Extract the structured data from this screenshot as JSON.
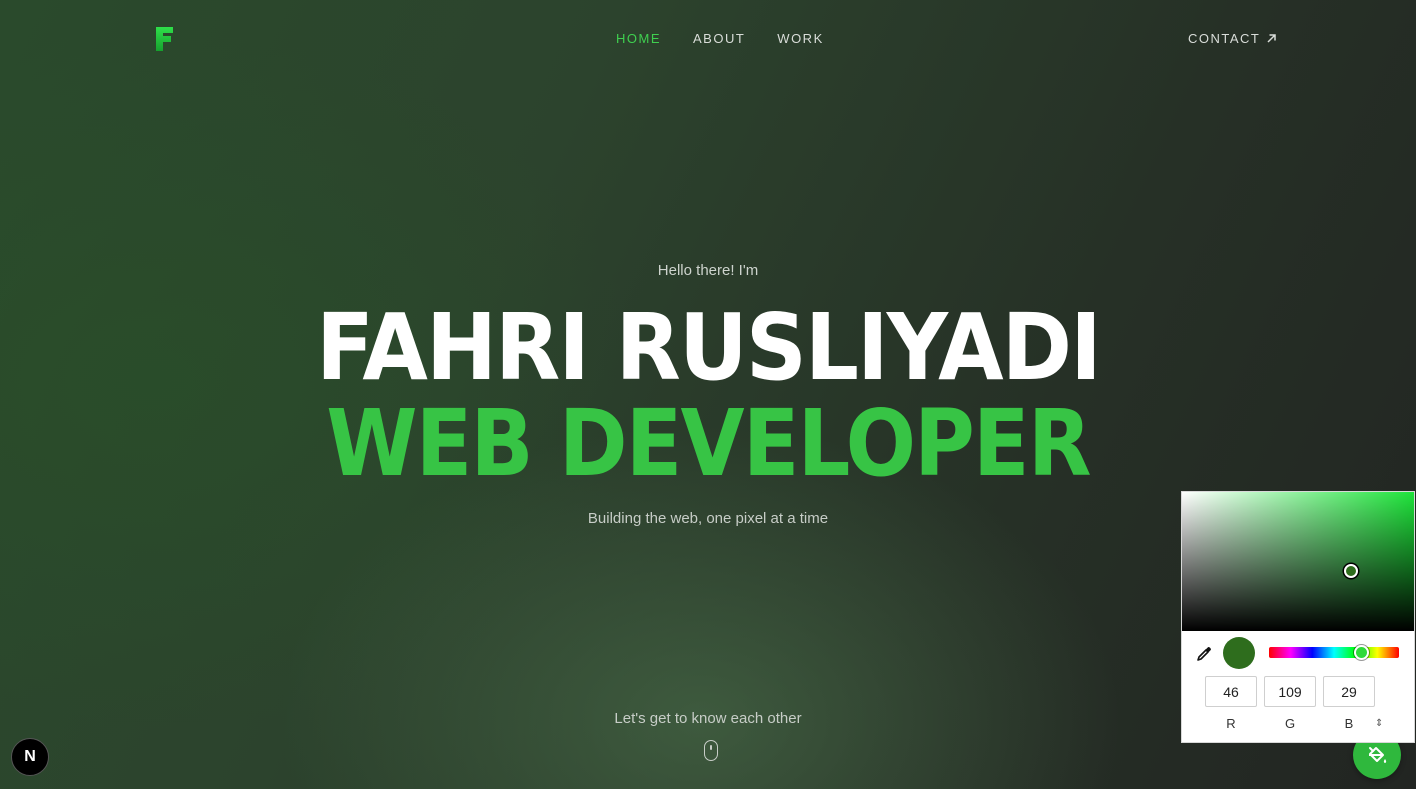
{
  "nav": {
    "links": [
      {
        "label": "HOME"
      },
      {
        "label": "ABOUT"
      },
      {
        "label": "WORK"
      }
    ],
    "contact_label": "CONTACT",
    "active_color": "#3fcf4f"
  },
  "hero": {
    "greeting": "Hello there! I'm",
    "name": "FAHRI RUSLIYADI",
    "role": "WEB DEVELOPER",
    "tagline": "Building the web, one pixel at a time",
    "scroll_hint": "Let's get to know each other",
    "accent_color": "#37c445"
  },
  "next_badge": {
    "label": "N"
  },
  "color_picker": {
    "rgb": {
      "r": "46",
      "g": "109",
      "b": "29"
    },
    "labels": {
      "r": "R",
      "g": "G",
      "b": "B"
    },
    "swatch_color": "#2e6d1d"
  }
}
